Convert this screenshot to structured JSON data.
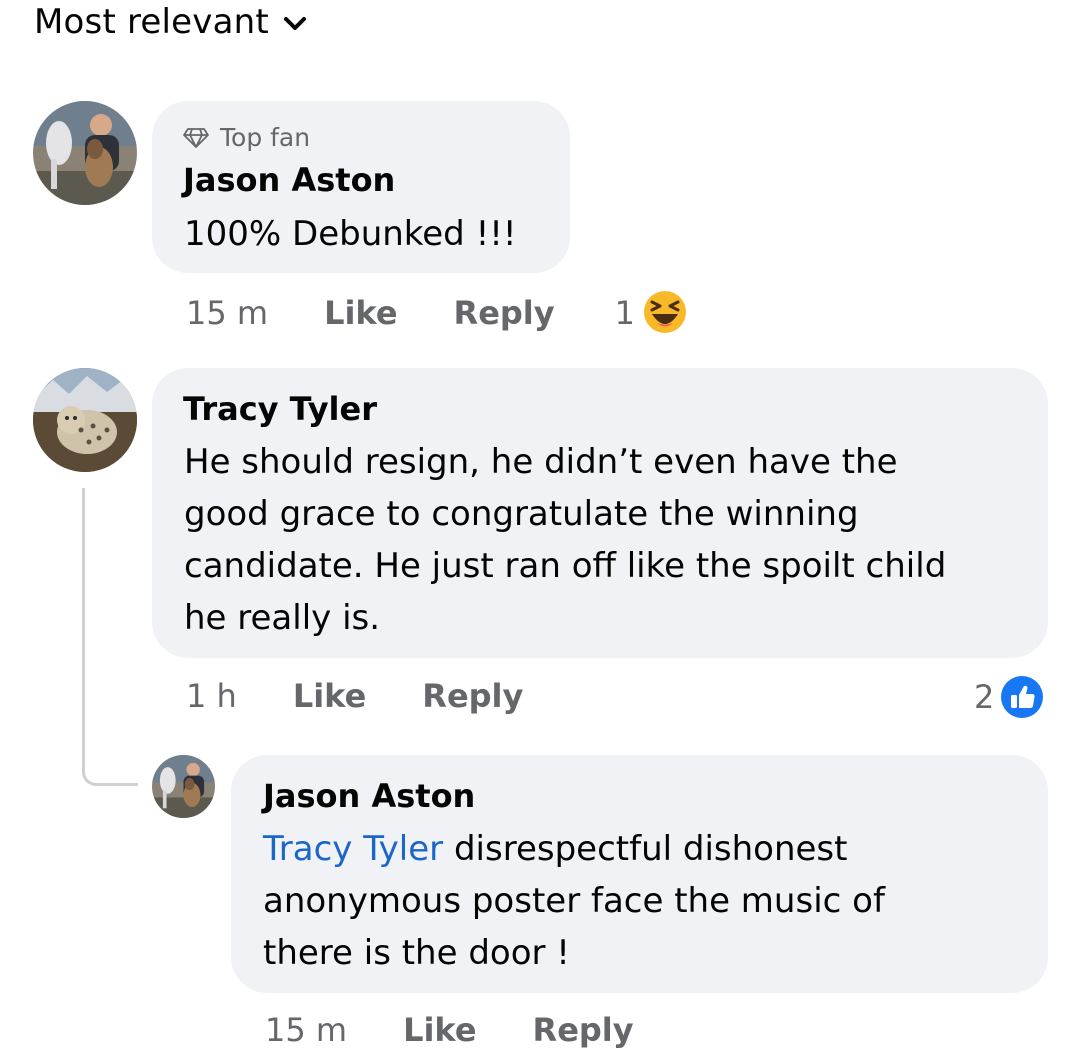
{
  "sort": {
    "label": "Most relevant",
    "icon": "chevron-down-icon"
  },
  "comments": [
    {
      "badge": "Top fan",
      "badge_icon": "diamond-icon",
      "author": "Jason Aston",
      "text": "100% Debunked !!!",
      "time": "15 m",
      "like_label": "Like",
      "reply_label": "Reply",
      "reaction_count": "1",
      "reaction_icon": "haha-reaction-icon"
    },
    {
      "author": "Tracy Tyler",
      "lines": [
        "He should resign, he didn’t even have the",
        "good grace to congratulate the winning",
        "candidate. He just ran off like the spoilt child",
        "he really is."
      ],
      "time": "1 h",
      "like_label": "Like",
      "reply_label": "Reply",
      "reaction_count": "2",
      "reaction_icon": "like-reaction-icon"
    }
  ],
  "reply": {
    "author": "Jason Aston",
    "mention": "Tracy Tyler",
    "first_line_rest": " disrespectful dishonest",
    "lines": [
      "anonymous poster face the music of",
      "there is the door !"
    ],
    "time": "15 m",
    "like_label": "Like",
    "reply_label": "Reply"
  },
  "colors": {
    "bubble": "#f0f2f5",
    "secondary_text": "#65676b",
    "mention": "#1b66c9",
    "like_blue": "#1877f2",
    "haha_yellow": "#f7b928"
  }
}
